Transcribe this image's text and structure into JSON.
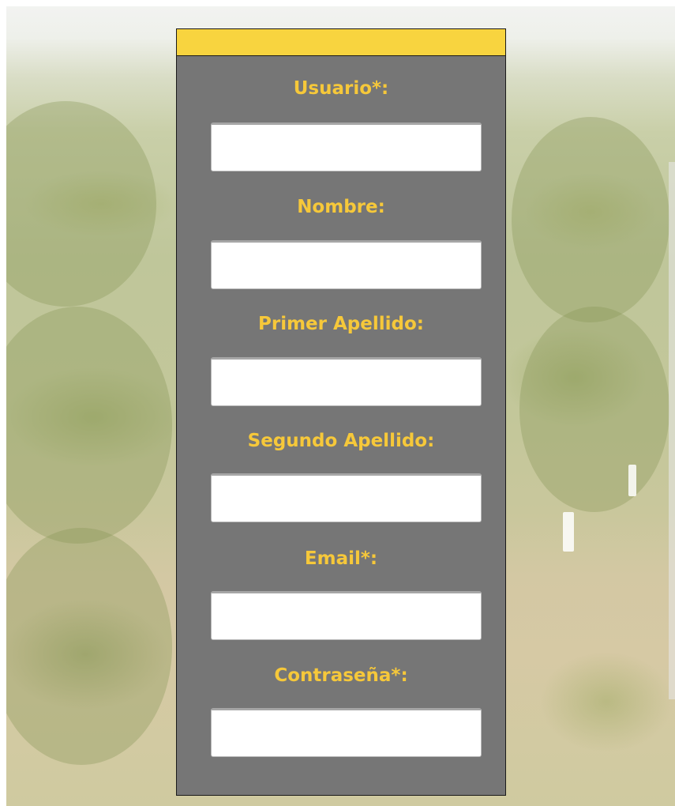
{
  "form": {
    "header_color": "#f8d43f",
    "label_color": "#f6c83a",
    "panel_color": "#767676",
    "fields": [
      {
        "id": "usuario",
        "label": "Usuario*:",
        "value": "",
        "placeholder": ""
      },
      {
        "id": "nombre",
        "label": "Nombre:",
        "value": "",
        "placeholder": ""
      },
      {
        "id": "primer_apellido",
        "label": "Primer Apellido:",
        "value": "",
        "placeholder": ""
      },
      {
        "id": "segundo_apellido",
        "label": "Segundo Apellido:",
        "value": "",
        "placeholder": ""
      },
      {
        "id": "email",
        "label": "Email*:",
        "value": "",
        "placeholder": ""
      },
      {
        "id": "contrasena",
        "label": "Contraseña*:",
        "value": "",
        "placeholder": ""
      }
    ]
  }
}
